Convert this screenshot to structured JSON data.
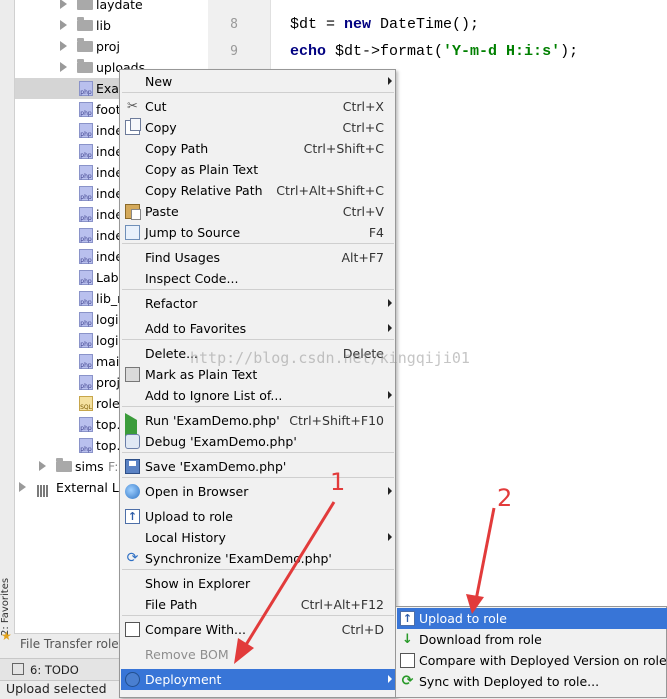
{
  "tree": {
    "items": [
      {
        "label": "laydate",
        "kind": "folder"
      },
      {
        "label": "lib",
        "kind": "folder"
      },
      {
        "label": "proj",
        "kind": "folder"
      },
      {
        "label": "uploads",
        "kind": "folder"
      },
      {
        "label": "Exam",
        "kind": "php"
      },
      {
        "label": "foot",
        "kind": "php"
      },
      {
        "label": "inde",
        "kind": "php"
      },
      {
        "label": "inde",
        "kind": "php"
      },
      {
        "label": "inde",
        "kind": "php"
      },
      {
        "label": "inde",
        "kind": "php"
      },
      {
        "label": "inde",
        "kind": "php"
      },
      {
        "label": "inde",
        "kind": "php"
      },
      {
        "label": "inde",
        "kind": "php"
      },
      {
        "label": "Labe",
        "kind": "php"
      },
      {
        "label": "lib_r",
        "kind": "php"
      },
      {
        "label": "logi",
        "kind": "php"
      },
      {
        "label": "logi",
        "kind": "php"
      },
      {
        "label": "mair",
        "kind": "php"
      },
      {
        "label": "proj",
        "kind": "php"
      },
      {
        "label": "role",
        "kind": "sql"
      },
      {
        "label": "top.",
        "kind": "php"
      },
      {
        "label": "top.",
        "kind": "php"
      }
    ],
    "sims_label": "sims",
    "sims_suffix": "F:",
    "external_label": "External Lib",
    "php_icon_text": "php",
    "sql_icon_text": "SQL"
  },
  "editor": {
    "line_numbers": [
      "8",
      "9"
    ],
    "line8": {
      "var": "$dt = ",
      "kw": "new",
      "rest": " DateTime();"
    },
    "line9": {
      "kw": "echo",
      "mid": " $dt->format(",
      "str": "'Y-m-d H:i:s'",
      "end": ");"
    }
  },
  "context_menu": {
    "items": [
      {
        "label": "New",
        "shortcut": "",
        "submenu": true
      },
      {
        "label": "Cut",
        "shortcut": "Ctrl+X",
        "icon": "scissors-icon"
      },
      {
        "label": "Copy",
        "shortcut": "Ctrl+C",
        "icon": "copy-icon"
      },
      {
        "label": "Copy Path",
        "shortcut": "Ctrl+Shift+C"
      },
      {
        "label": "Copy as Plain Text",
        "shortcut": ""
      },
      {
        "label": "Copy Relative Path",
        "shortcut": "Ctrl+Alt+Shift+C"
      },
      {
        "label": "Paste",
        "shortcut": "Ctrl+V",
        "icon": "paste-icon"
      },
      {
        "label": "Jump to Source",
        "shortcut": "F4",
        "icon": "jump-to-source-icon"
      },
      {
        "label": "Find Usages",
        "shortcut": "Alt+F7"
      },
      {
        "label": "Inspect Code...",
        "shortcut": ""
      },
      {
        "label": "Refactor",
        "shortcut": "",
        "submenu": true
      },
      {
        "label": "Add to Favorites",
        "shortcut": "",
        "submenu": true
      },
      {
        "label": "Delete...",
        "shortcut": "Delete"
      },
      {
        "label": "Mark as Plain Text",
        "shortcut": "",
        "icon": "plain-text-icon"
      },
      {
        "label": "Add to Ignore List of...",
        "shortcut": "",
        "submenu": true
      },
      {
        "label": "Run 'ExamDemo.php'",
        "shortcut": "Ctrl+Shift+F10",
        "icon": "run-icon"
      },
      {
        "label": "Debug 'ExamDemo.php'",
        "shortcut": "",
        "icon": "debug-icon"
      },
      {
        "label": "Save 'ExamDemo.php'",
        "shortcut": "",
        "icon": "save-icon"
      },
      {
        "label": "Open in Browser",
        "shortcut": "",
        "submenu": true,
        "icon": "browser-icon"
      },
      {
        "label": "Upload to role",
        "shortcut": "",
        "icon": "upload-icon"
      },
      {
        "label": "Local History",
        "shortcut": "",
        "submenu": true
      },
      {
        "label": "Synchronize 'ExamDemo.php'",
        "shortcut": "",
        "icon": "synchronize-icon"
      },
      {
        "label": "Show in Explorer",
        "shortcut": ""
      },
      {
        "label": "File Path",
        "shortcut": "Ctrl+Alt+F12"
      },
      {
        "label": "Compare With...",
        "shortcut": "Ctrl+D",
        "icon": "compare-icon"
      },
      {
        "label": "Remove BOM",
        "shortcut": "",
        "disabled": true
      },
      {
        "label": "Deployment",
        "shortcut": "",
        "submenu": true,
        "active": true,
        "icon": "deployment-icon"
      }
    ]
  },
  "deployment_submenu": {
    "items": [
      {
        "label": "Upload to role",
        "icon": "upload-icon",
        "active": true
      },
      {
        "label": "Download from role",
        "icon": "download-icon"
      },
      {
        "label": "Compare with Deployed Version on role",
        "icon": "compare-icon"
      },
      {
        "label": "Sync with Deployed to role...",
        "icon": "sync-icon"
      }
    ]
  },
  "bottom": {
    "favorites_label": "2: Favorites",
    "file_transfer_label": "File Transfer role",
    "todo_label": "6: TODO",
    "status_text": "Upload selected"
  },
  "watermark": "http://blog.csdn.net/kingqiji01",
  "annotations": {
    "one": "1",
    "two": "2",
    "color": "#e23b3b"
  },
  "colors": {
    "selection": "#3875d7",
    "menu_bg": "#f1f1f1"
  }
}
